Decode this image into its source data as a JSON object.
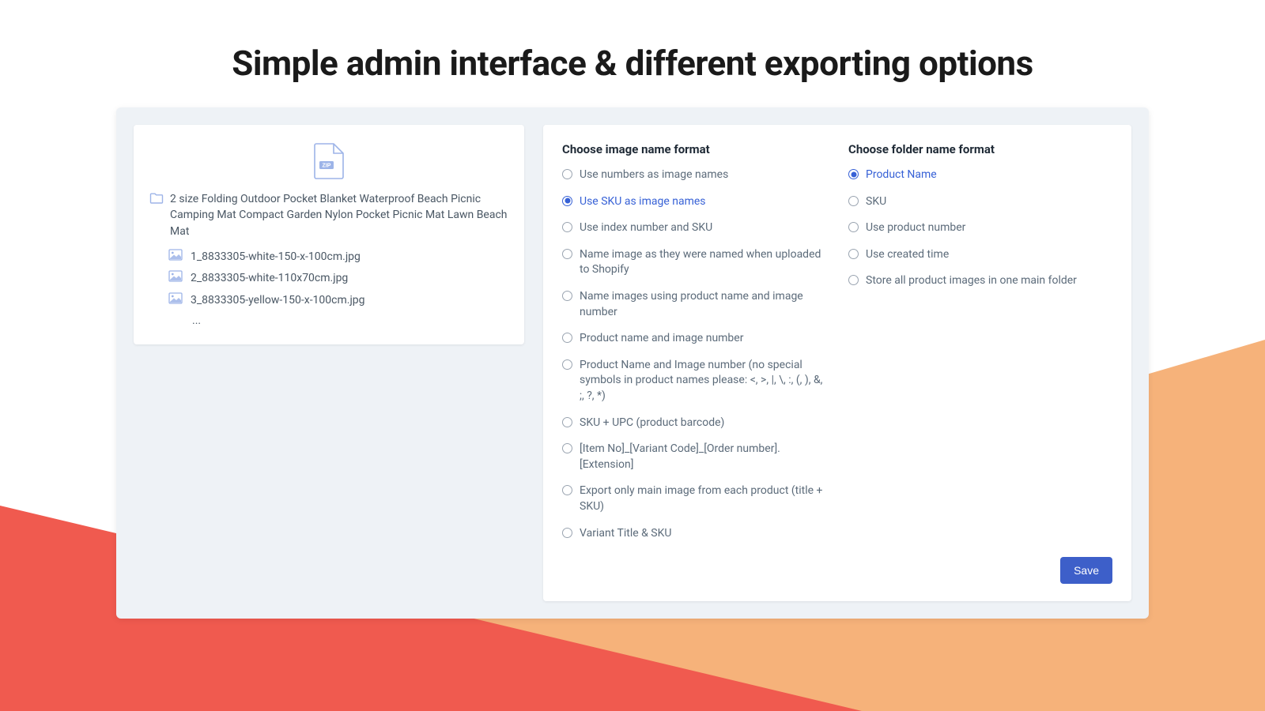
{
  "page_title": "Simple admin interface & different exporting options",
  "preview": {
    "zip_label": "ZIP",
    "folder_name": "2 size Folding Outdoor Pocket Blanket Waterproof Beach Picnic Camping Mat Compact Garden Nylon Pocket Picnic Mat Lawn Beach Mat",
    "files": [
      "1_8833305-white-150-x-100cm.jpg",
      "2_8833305-white-110x70cm.jpg",
      "3_8833305-yellow-150-x-100cm.jpg"
    ],
    "ellipsis": "..."
  },
  "image_name_format": {
    "title": "Choose image name format",
    "selected_index": 1,
    "options": [
      "Use numbers as image names",
      "Use SKU as image names",
      "Use index number and SKU",
      "Name image as they were named when uploaded to Shopify",
      "Name images using product name and image number",
      "Product name and image number",
      "Product Name and Image number (no special symbols in product names please: <, >, |, \\, :, (, ), &, ;, ?, *)",
      "SKU + UPC (product barcode)",
      "[Item No]_[Variant Code]_[Order number].[Extension]",
      "Export only main image from each product (title + SKU)",
      "Variant Title & SKU"
    ]
  },
  "folder_name_format": {
    "title": "Choose folder name format",
    "selected_index": 0,
    "options": [
      "Product Name",
      "SKU",
      "Use product number",
      "Use created time",
      "Store all product images in one main folder"
    ]
  },
  "save_label": "Save",
  "colors": {
    "accent": "#3761d6",
    "bg_surface": "#eef2f6",
    "button": "#3d5fc9",
    "tri_left": "#f05a4f",
    "tri_right": "#f6b27a"
  }
}
